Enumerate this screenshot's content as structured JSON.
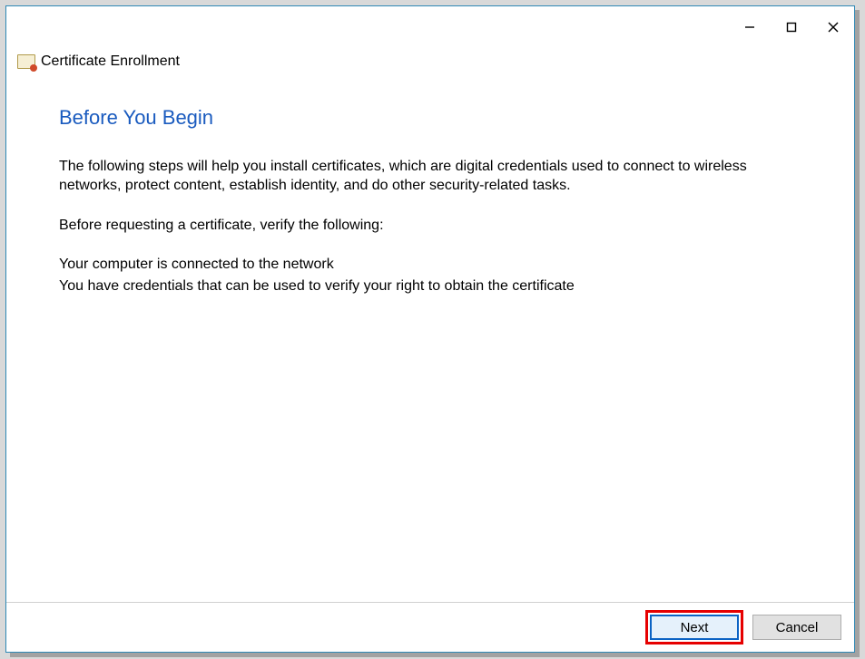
{
  "wizard_name": "Certificate Enrollment",
  "heading": "Before You Begin",
  "intro": "The following steps will help you install certificates, which are digital credentials used to connect to wireless networks, protect content, establish identity, and do other security-related tasks.",
  "verify_heading": "Before requesting a certificate, verify the following:",
  "verify_items": {
    "a": "Your computer is connected to the network",
    "b": "You have credentials that can be used to verify your right to obtain the certificate"
  },
  "buttons": {
    "next": "Next",
    "cancel": "Cancel"
  }
}
